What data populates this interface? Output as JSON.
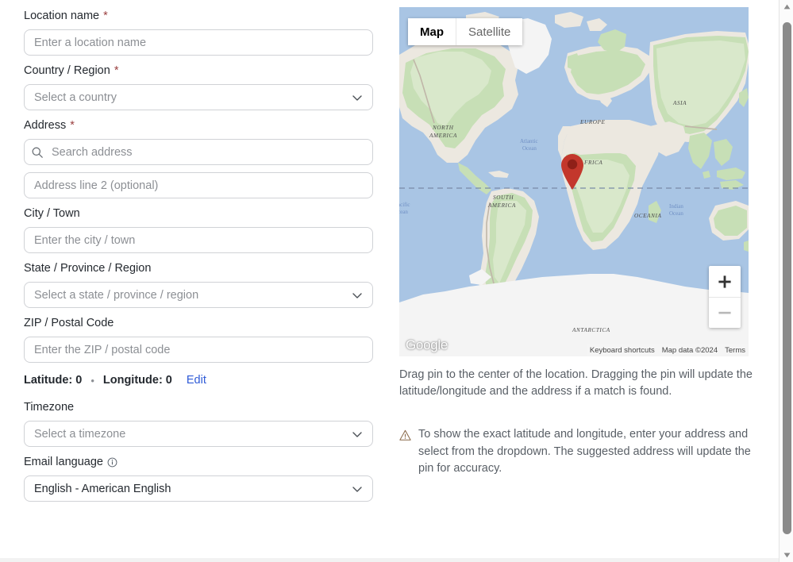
{
  "form": {
    "fields": [
      {
        "id": "location-name",
        "label": "Location name",
        "required": true,
        "type": "text",
        "placeholder": "Enter a location name",
        "value": ""
      },
      {
        "id": "country-region",
        "label": "Country / Region",
        "required": true,
        "type": "select",
        "placeholder": "Select a country",
        "value": ""
      },
      {
        "id": "address",
        "label": "Address",
        "required": true,
        "type": "search",
        "placeholder": "Search address",
        "value": "",
        "icon": "search-icon"
      },
      {
        "id": "address-line-2",
        "label": "",
        "required": false,
        "type": "text",
        "placeholder": "Address line 2 (optional)",
        "value": ""
      },
      {
        "id": "city-town",
        "label": "City / Town",
        "required": false,
        "type": "text",
        "placeholder": "Enter the city / town",
        "value": ""
      },
      {
        "id": "state-province-region",
        "label": "State / Province / Region",
        "required": false,
        "type": "select",
        "placeholder": "Select a state / province / region",
        "value": ""
      },
      {
        "id": "zip-postal-code",
        "label": "ZIP / Postal Code",
        "required": false,
        "type": "text",
        "placeholder": "Enter the ZIP / postal code",
        "value": ""
      },
      {
        "id": "timezone",
        "label": "Timezone",
        "required": false,
        "type": "select",
        "placeholder": "Select a timezone",
        "value": ""
      },
      {
        "id": "email-language",
        "label": "Email language",
        "required": false,
        "type": "select",
        "placeholder": "",
        "value": "English - American English",
        "info_icon": "info-circle-icon"
      }
    ],
    "coordinates": {
      "latitude_label": "Latitude: 0",
      "separator": "•",
      "longitude_label": "Longitude: 0",
      "edit_link": "Edit"
    },
    "required_marker": "*"
  },
  "map": {
    "type_toggle": [
      {
        "label": "Map",
        "active": true
      },
      {
        "label": "Satellite",
        "active": false
      }
    ],
    "zoom_controls": {
      "zoom_in": "+",
      "zoom_out": "−"
    },
    "watermark": "Google",
    "attribution": [
      "Keyboard shortcuts",
      "Map data ©2024",
      "Terms"
    ],
    "labels": [
      "NORTH AMERICA",
      "EUROPE",
      "ASIA",
      "AFRICA",
      "SOUTH AMERICA",
      "OCEANIA",
      "ANTARCTICA",
      "Atlantic Ocean",
      "Pacific Ocean",
      "Indian Ocean"
    ],
    "pin": {
      "color": "#c3372c",
      "latitude": 0,
      "longitude": 0
    }
  },
  "help": {
    "drag_text": "Drag pin to the center of the location. Dragging the pin will update the latitude/longitude and the address if a match is found.",
    "warning_icon": "warning-triangle-icon",
    "warning_text": "To show the exact latitude and longitude, enter your address and select from the dropdown. The suggested address will update the pin for accuracy."
  },
  "colors": {
    "link": "#2f5bd7",
    "required": "#9a3f3f",
    "warning": "#8a6a4a",
    "pin": "#c3372c",
    "border": "#d0d2d6",
    "placeholder": "#8c8f94"
  },
  "scrollbar": {
    "up_arrow": "▲",
    "down_arrow": "▼"
  }
}
